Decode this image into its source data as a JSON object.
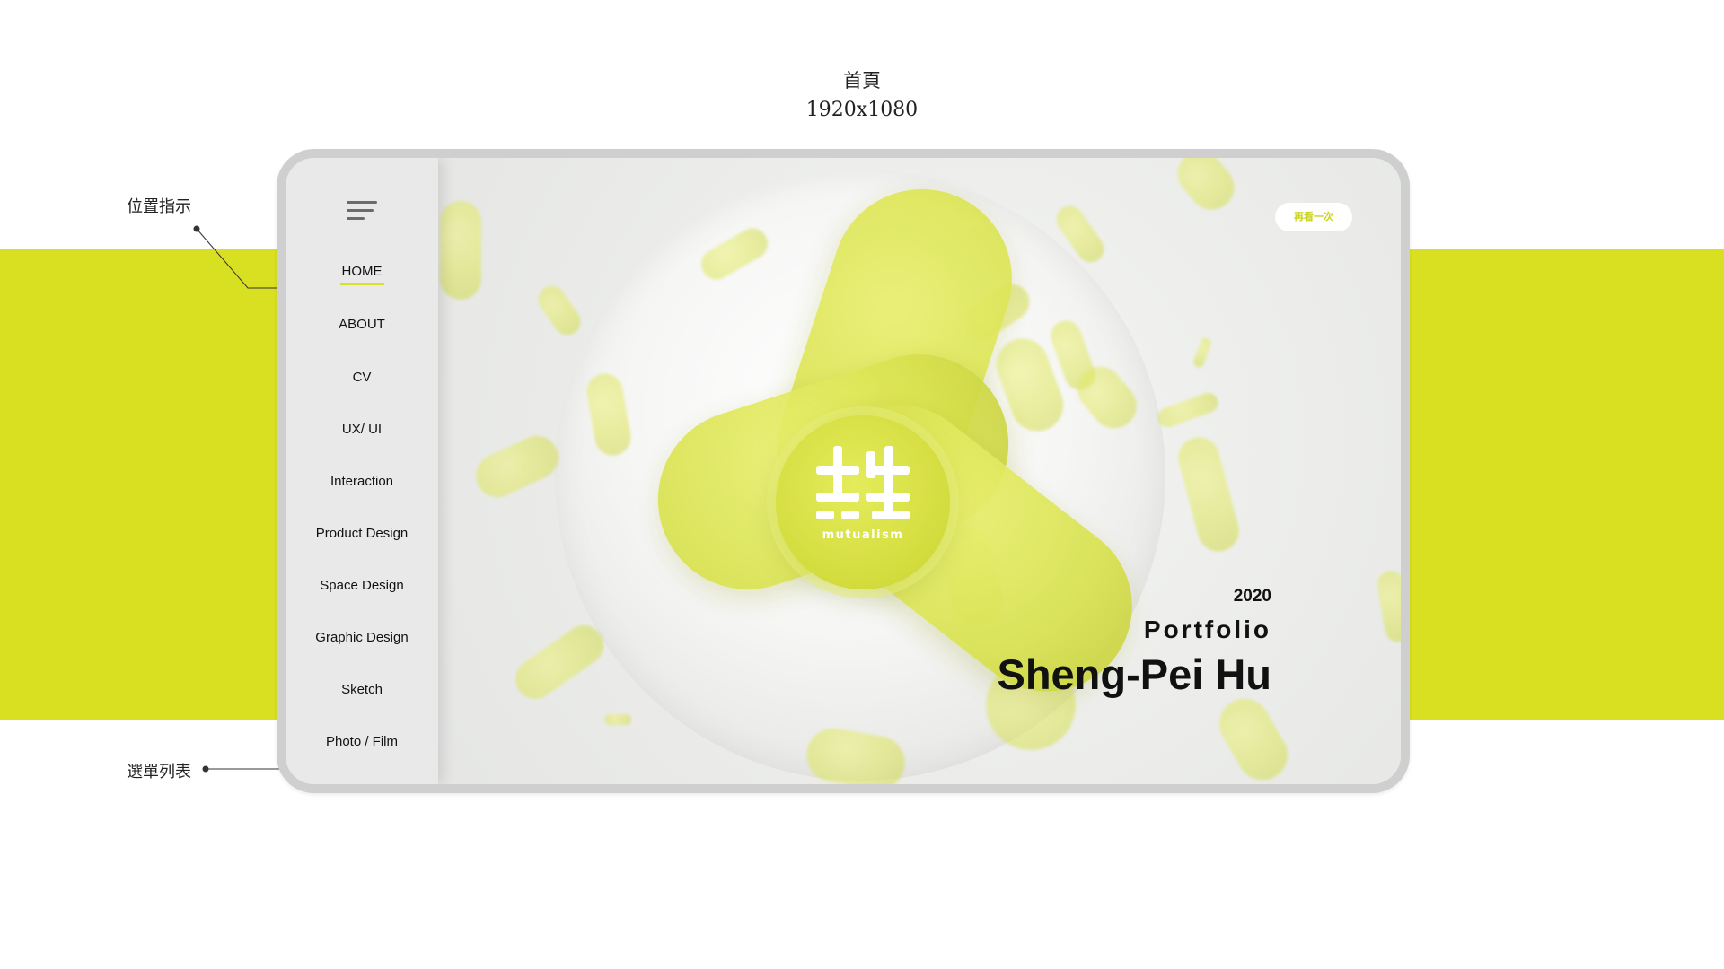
{
  "caption": {
    "title": "首頁",
    "size": "1920x1080"
  },
  "annotations": {
    "position_indicator": "位置指示",
    "menu_list": "選單列表"
  },
  "nav": {
    "items": [
      {
        "label": "HOME"
      },
      {
        "label": "ABOUT"
      },
      {
        "label": "CV"
      },
      {
        "label": "UX/ UI"
      },
      {
        "label": "Interaction"
      },
      {
        "label": "Product Design"
      },
      {
        "label": "Space Design"
      },
      {
        "label": "Graphic Design"
      },
      {
        "label": "Sketch"
      },
      {
        "label": "Photo /  Film"
      }
    ],
    "active_index": 0
  },
  "hero": {
    "replay_button": "再看一次",
    "logo_text": "mutualism",
    "year": "2020",
    "subtitle": "Portfolio",
    "name": "Sheng-Pei Hu"
  },
  "colors": {
    "accent": "#d9e021",
    "text": "#111111"
  },
  "icons": {
    "menu": "hamburger-menu-icon"
  }
}
